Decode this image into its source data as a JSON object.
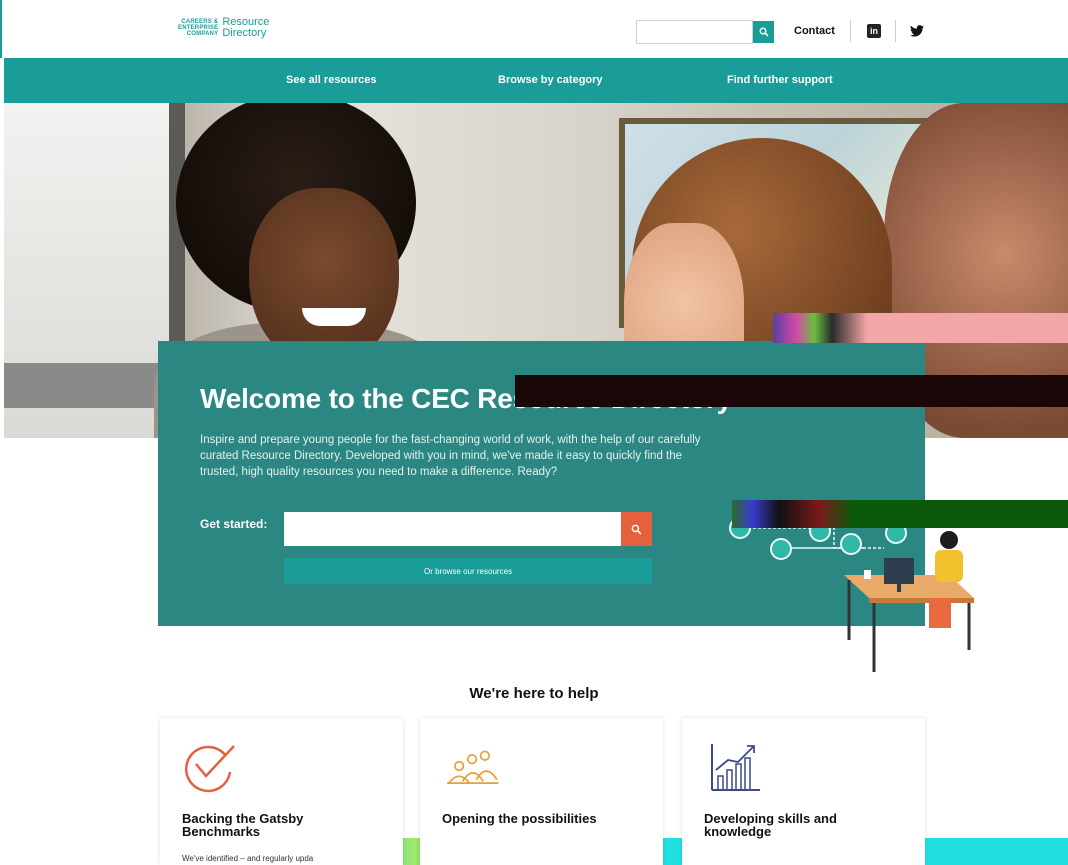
{
  "header": {
    "logo_mark_lines": [
      "CAREERS &",
      "ENTERPRISE",
      "COMPANY"
    ],
    "logo_text_lines": [
      "Resource",
      "Directory"
    ],
    "search_placeholder": "",
    "contact_label": "Contact",
    "linkedin_label": "in"
  },
  "nav": {
    "items": [
      {
        "label": "See all resources"
      },
      {
        "label": "Browse by category"
      },
      {
        "label": "Find further support"
      }
    ]
  },
  "hero": {
    "title": "Welcome to the CEC Resource Directory",
    "description": "Inspire and prepare young people for the fast-changing world of work, with the help of our carefully curated Resource Directory. Developed with you in mind, we've made it easy to quickly find the trusted, high quality resources you need to make a difference. Ready?",
    "get_started_label": "Get started:",
    "search_value": "",
    "browse_label": "Or browse our resources"
  },
  "help": {
    "title": "We're here to help",
    "cards": [
      {
        "title": "Backing the Gatsby Benchmarks",
        "text": "We've identified – and regularly upda",
        "icon": "checkmark-circle-icon"
      },
      {
        "title": "Opening the possibilities",
        "text": "",
        "icon": "people-group-icon"
      },
      {
        "title": "Developing skills and knowledge",
        "text": "",
        "icon": "growth-chart-icon"
      }
    ]
  },
  "colors": {
    "teal": "#1a9c98",
    "panel_teal": "#2a8781",
    "accent_orange": "#e5603d"
  }
}
